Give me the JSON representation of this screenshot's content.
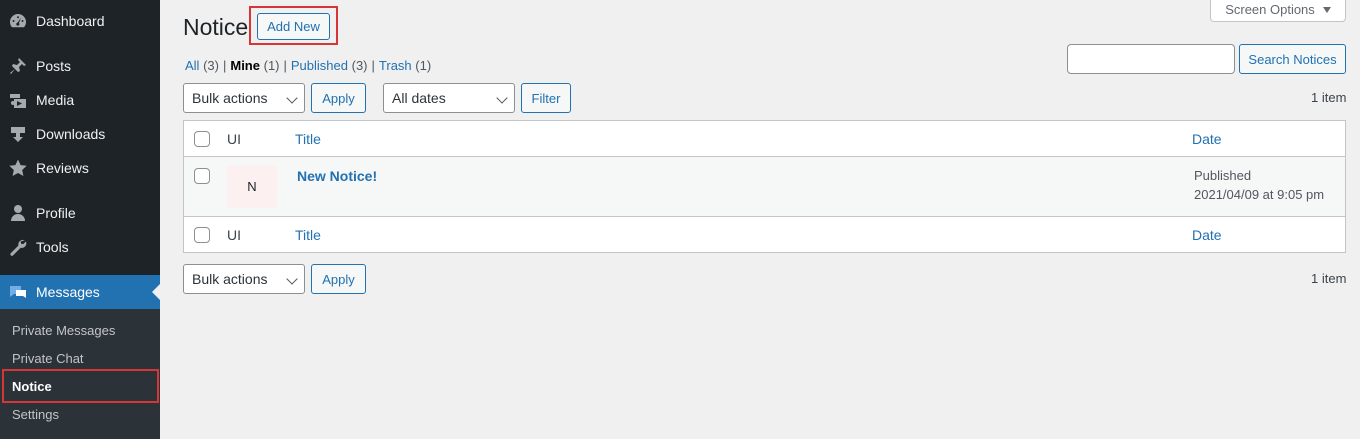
{
  "sidebar": {
    "items": [
      {
        "label": "Dashboard",
        "icon": "dashboard-icon"
      },
      {
        "label": "Posts",
        "icon": "pin-icon"
      },
      {
        "label": "Media",
        "icon": "media-icon"
      },
      {
        "label": "Downloads",
        "icon": "download-icon"
      },
      {
        "label": "Reviews",
        "icon": "star-icon"
      },
      {
        "label": "Profile",
        "icon": "user-icon"
      },
      {
        "label": "Tools",
        "icon": "wrench-icon"
      },
      {
        "label": "Messages",
        "icon": "chat-bubbles-icon",
        "active": true
      }
    ],
    "submenu": [
      {
        "label": "Private Messages"
      },
      {
        "label": "Private Chat"
      },
      {
        "label": "Notice",
        "current": true
      },
      {
        "label": "Settings"
      }
    ]
  },
  "header": {
    "title": "Notice",
    "add_new_label": "Add New",
    "screen_options_label": "Screen Options"
  },
  "filters": {
    "views": [
      {
        "label": "All",
        "count": "(3)"
      },
      {
        "label": "Mine",
        "count": "(1)"
      },
      {
        "label": "Published",
        "count": "(3)"
      },
      {
        "label": "Trash",
        "count": "(1)"
      }
    ],
    "separator": "|",
    "search_button_label": "Search Notices",
    "search_value": ""
  },
  "tablenav_top": {
    "bulk_actions": "Bulk actions",
    "apply_label": "Apply",
    "dates": "All dates",
    "filter_label": "Filter",
    "items_count": "1 item"
  },
  "table": {
    "columns": {
      "ui": "UI",
      "title": "Title",
      "date": "Date"
    },
    "rows": [
      {
        "avatar_letter": "N",
        "title": "New Notice!",
        "status": "Published",
        "date": "2021/04/09 at 9:05 pm"
      }
    ]
  },
  "tablenav_bottom": {
    "bulk_actions": "Bulk actions",
    "apply_label": "Apply",
    "items_count": "1 item"
  },
  "colors": {
    "sidebar_bg": "#1d2327",
    "submenu_bg": "#2c3338",
    "accent": "#2271b1",
    "highlight": "#d63638"
  }
}
